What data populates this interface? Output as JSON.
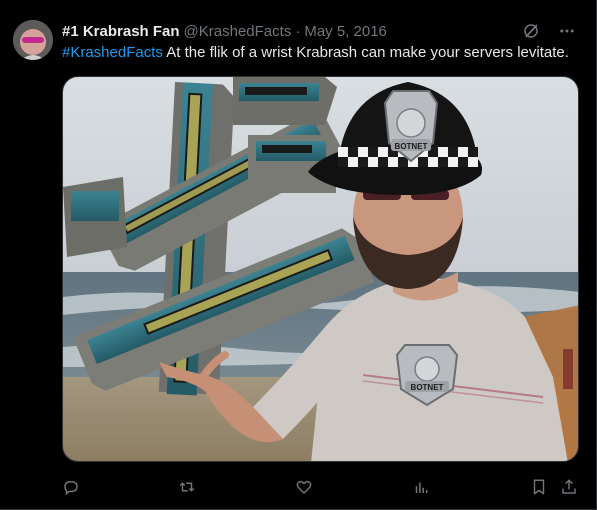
{
  "tweet": {
    "display_name": "#1 Krabrash Fan",
    "handle": "@KrashedFacts",
    "separator": "·",
    "date": "May 5, 2016",
    "hashtag": "#KrashedFacts",
    "text": " At the flik of a wrist Krabrash can make your servers levitate."
  },
  "media": {
    "hat_badge_text": "BOTNET",
    "shirt_badge_text": "BOTNET"
  },
  "icons": {
    "grok": "grok-icon",
    "more": "more-icon",
    "reply": "reply-icon",
    "retweet": "retweet-icon",
    "like": "like-icon",
    "views": "views-icon",
    "bookmark": "bookmark-icon",
    "share": "share-icon"
  },
  "colors": {
    "background": "#000000",
    "text": "#e7e9ea",
    "muted": "#71767b",
    "accent": "#1d9bf0",
    "border": "#2f3336"
  }
}
